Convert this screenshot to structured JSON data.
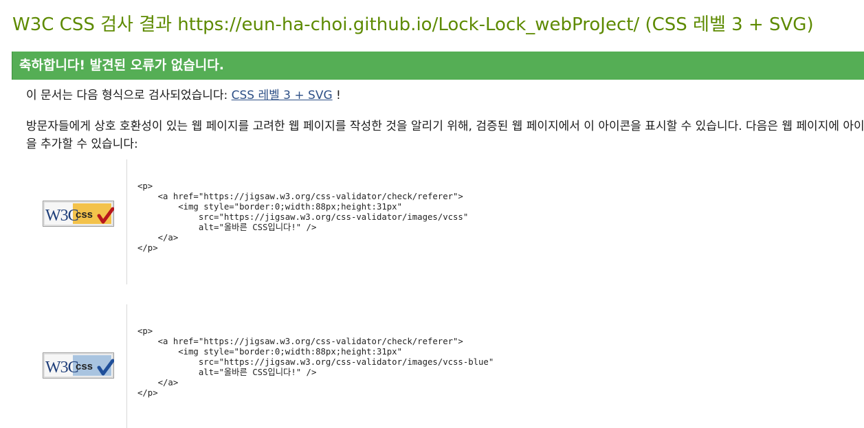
{
  "header": {
    "title": "W3C CSS 검사 결과 https://eun-ha-choi.github.io/Lock-Lock_webProJect/ (CSS 레벨 3 + SVG)"
  },
  "result": {
    "success_message": "축하합니다! 발견된 오류가 없습니다."
  },
  "intro": {
    "prefix": "이 문서는 다음 형식으로 검사되었습니다: ",
    "link_text": "CSS 레벨 3 + SVG",
    "suffix": " !"
  },
  "badges_info": {
    "text": "방문자들에게 상호 호환성이 있는 웹 페이지를 고려한 웹 페이지를 작성한 것을 알리기 위해, 검증된 웹 페이지에서 이 아이콘을 표시할 수 있습니다. 다음은 웹 페이지에 아이콘을 추가할 수 있습니다:"
  },
  "badges": [
    {
      "label_w3c": "W3C",
      "label_css": "css",
      "variant": "gold",
      "colors": {
        "panel": "#f3c24b",
        "check": "#b8161c"
      },
      "code": "<p>\n    <a href=\"https://jigsaw.w3.org/css-validator/check/referer\">\n        <img style=\"border:0;width:88px;height:31px\"\n            src=\"https://jigsaw.w3.org/css-validator/images/vcss\"\n            alt=\"올바른 CSS입니다!\" />\n    </a>\n</p>"
    },
    {
      "label_w3c": "W3C",
      "label_css": "css",
      "variant": "blue",
      "colors": {
        "panel": "#a9c4e0",
        "check": "#1f4f9a"
      },
      "code": "<p>\n    <a href=\"https://jigsaw.w3.org/css-validator/check/referer\">\n        <img style=\"border:0;width:88px;height:31px\"\n            src=\"https://jigsaw.w3.org/css-validator/images/vcss-blue\"\n            alt=\"올바른 CSS입니다!\" />\n    </a>\n</p>"
    }
  ]
}
